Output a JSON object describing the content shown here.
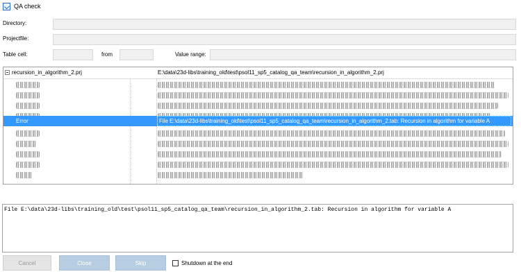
{
  "window": {
    "title": "QA check",
    "icon": "qa-check-icon"
  },
  "form": {
    "directory_label": "Directory:",
    "directory_value": "",
    "projectfile_label": "Projectfile:",
    "projectfile_value": "",
    "table_cell_label": "Table cell:",
    "table_cell_value": "",
    "from_label": "from",
    "from_value": "",
    "value_range_label": "Value range:",
    "value_range_value": ""
  },
  "tree": {
    "root": {
      "name": "recursion_in_algorithm_2.prj",
      "path": "E:\\data\\23d-libs\\training_old\\test\\psol11_sp5_catalog_qa_team\\recursion_in_algorithm_2.prj",
      "expand_icon": "collapse-icon"
    },
    "selected_row": {
      "type": "Error",
      "message": "File E:\\data\\23d-libs\\training_old\\test\\psol11_sp5_catalog_qa_team\\recursion_in_algorithm_2.tab: Recursion in algorithm for variable A"
    }
  },
  "details": {
    "text": "File E:\\data\\23d-libs\\training_old\\test\\psol11_sp5_catalog_qa_team\\recursion_in_algorithm_2.tab: Recursion in algorithm for variable A"
  },
  "buttons": {
    "cancel": "Cancel",
    "close": "Close",
    "skip": "Skip"
  },
  "shutdown": {
    "label": "Shutdown at the end",
    "checked": false
  },
  "colors": {
    "selection": "#3399ff",
    "button_disabled": "#b7cde1",
    "field_bg": "#f0f0f0"
  }
}
